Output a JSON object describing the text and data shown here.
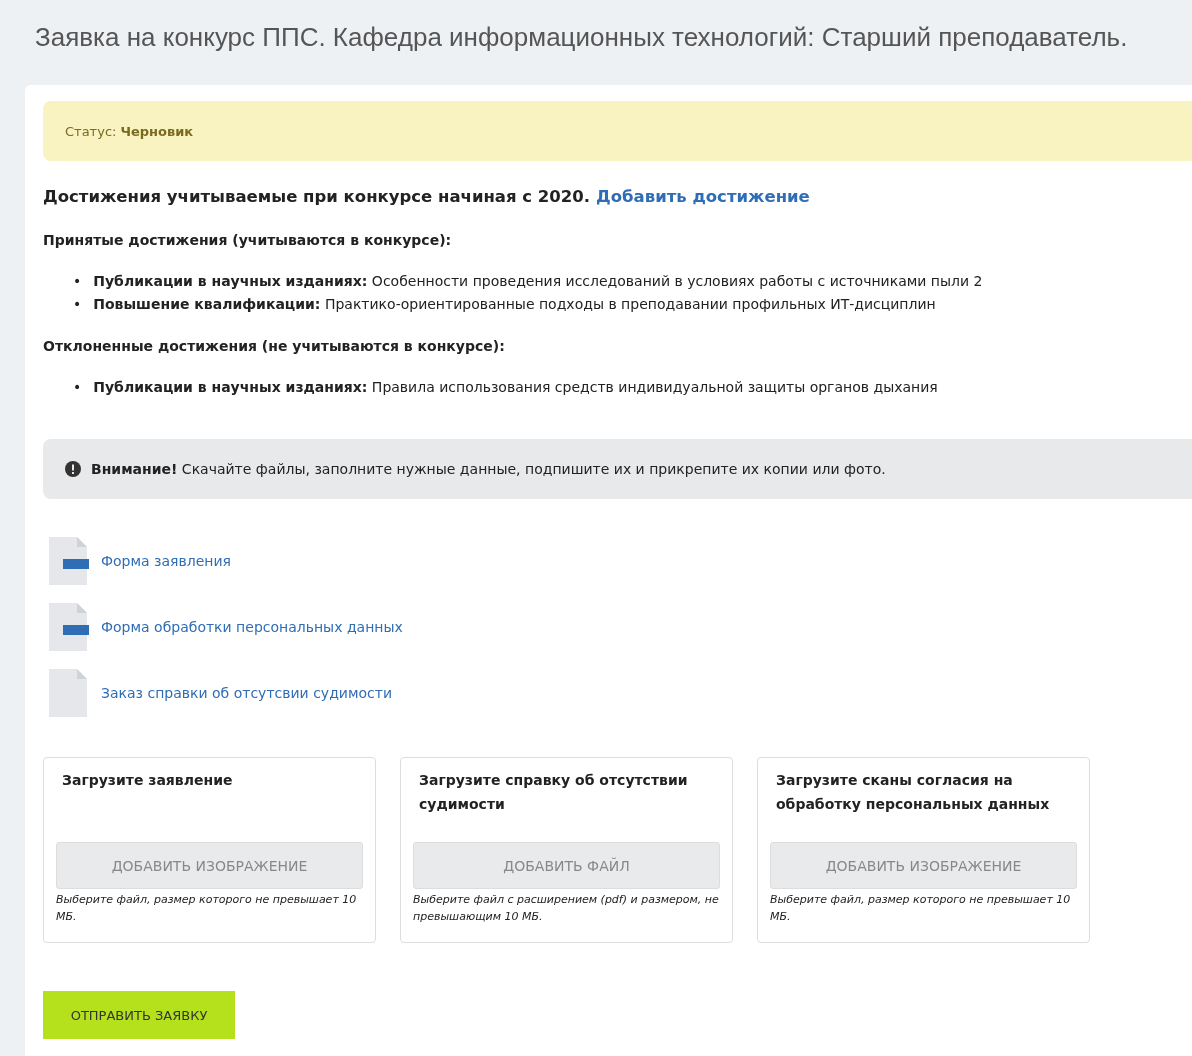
{
  "page_title": "Заявка на конкурс ППС. Кафедра информационных технологий: Старший преподаватель.",
  "status": {
    "label": "Статус:",
    "value": "Черновик"
  },
  "achievements": {
    "heading": "Достижения учитываемые при конкурсе начиная с 2020.",
    "add_link": "Добавить достижение",
    "groups": [
      {
        "title": "Принятые достижения (учитываются в конкурсе):",
        "items": [
          {
            "marker": "•",
            "category": "Публикации в научных изданиях:",
            "name": "Особенности проведения исследований в условиях работы с источниками пыли 2"
          },
          {
            "marker": "•",
            "category": "Повышение квалификации:",
            "name": "Практико-ориентированные подходы в преподавании профильных ИТ-дисциплин"
          }
        ]
      },
      {
        "title": "Отклоненные достижения (не учитываются в конкурсе):",
        "items": [
          {
            "marker": "•",
            "category": "Публикации в научных изданиях:",
            "name": "Правила использования средств индивидуальной защиты органов дыхания"
          }
        ]
      }
    ]
  },
  "notice": {
    "strong": "Внимание!",
    "text": "Скачайте файлы, заполните нужные данные, подпишите их и прикрепите их копии или фото."
  },
  "files": [
    {
      "kind": "doc",
      "label": "Форма заявления"
    },
    {
      "kind": "doc",
      "label": "Форма обработки персональных данных"
    },
    {
      "kind": "blank",
      "label": "Заказ справки об отсутсвии судимости"
    }
  ],
  "uploads": [
    {
      "title": "Загрузите заявление",
      "button": "ДОБАВИТЬ ИЗОБРАЖЕНИЕ",
      "hint": "Выберите файл, размер которого не превышает 10 МБ."
    },
    {
      "title": "Загрузите справку об отсутствии судимости",
      "button": "ДОБАВИТЬ ФАЙЛ",
      "hint": "Выберите файл с расширением (pdf) и размером, не превышающим 10 МБ."
    },
    {
      "title": "Загрузите сканы согласия на обработку персональных данных",
      "button": "ДОБАВИТЬ ИЗОБРАЖЕНИЕ",
      "hint": "Выберите файл, размер которого не превышает 10 МБ."
    }
  ],
  "submit_button": "ОТПРАВИТЬ ЗАЯВКУ"
}
